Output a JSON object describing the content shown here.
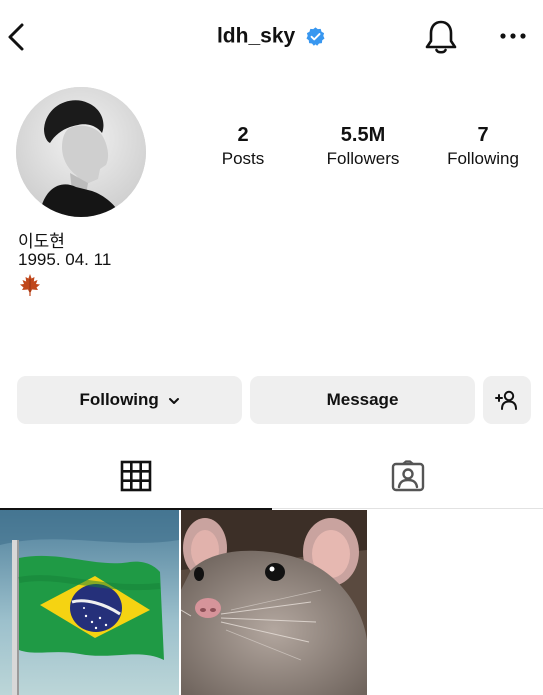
{
  "header": {
    "username": "ldh_sky",
    "verified_icon": "verified-badge-icon",
    "back_icon": "chevron-left-icon",
    "notifications_icon": "bell-icon",
    "more_icon": "more-horizontal-icon"
  },
  "profile": {
    "avatar": "profile-photo",
    "stats": [
      {
        "value": "2",
        "label": "Posts"
      },
      {
        "value": "5.5M",
        "label": "Followers"
      },
      {
        "value": "7",
        "label": "Following"
      }
    ],
    "bio": {
      "name": "이도현",
      "line2": "1995. 04. 11",
      "emoji": "maple-leaf-icon"
    }
  },
  "actions": {
    "following_label": "Following",
    "message_label": "Message",
    "add_user_icon": "add-user-icon"
  },
  "tabs": [
    {
      "icon": "grid-icon",
      "active": true
    },
    {
      "icon": "tagged-icon",
      "active": false
    }
  ],
  "posts": [
    {
      "thumbnail": "brazil-flag-photo"
    },
    {
      "thumbnail": "rat-photo"
    }
  ],
  "colors": {
    "verified_blue": "#3897f0",
    "button_bg": "#efefef",
    "text": "#111111"
  }
}
